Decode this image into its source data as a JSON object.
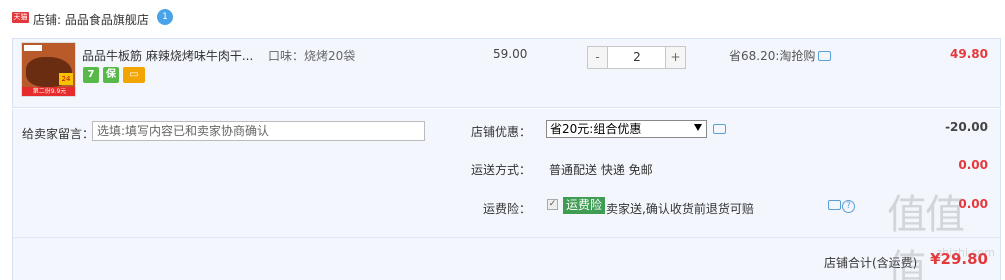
{
  "shop": {
    "badge": "天猫",
    "label": "店铺: 品品食品旗舰店"
  },
  "item": {
    "title": "品品牛板筋 麻辣烧烤味牛肉干...",
    "sku": "口味：烧烤20袋",
    "thumb_banner": "第二份9.9元",
    "thumb_badge": "24",
    "unit_price": "59.00",
    "quantity": "2",
    "minus_label": "-",
    "plus_label": "+",
    "promo": "省68.20:淘抢购",
    "total": "49.80",
    "service_icons": [
      "7-day-return-icon",
      "guarantee-icon",
      "card-icon"
    ]
  },
  "order": {
    "buyer_label": "给卖家留言：",
    "buyer_placeholder": "选填:填写内容已和卖家协商确认",
    "discount_label": "店铺优惠：",
    "discount_selected": "省20元:组合优惠",
    "discount_amount": "-20.00",
    "ship_label": "运送方式：",
    "ship_text": "普通配送 快递 免邮",
    "ship_amount": "0.00",
    "insurance_label": "运费险：",
    "insurance_badge": "运费险",
    "insurance_text": "卖家送,确认收货前退货可赔",
    "insurance_amount": "0.00",
    "total_label": "店铺合计(含运费)",
    "total_amount": "¥29.80"
  },
  "watermark": {
    "text": "值值值",
    "url": "zhizhi.com"
  },
  "colors": {
    "accent_red": "#e4393c",
    "panel_bg": "#f3f7fd",
    "insurance_green": "#3e9c53"
  }
}
